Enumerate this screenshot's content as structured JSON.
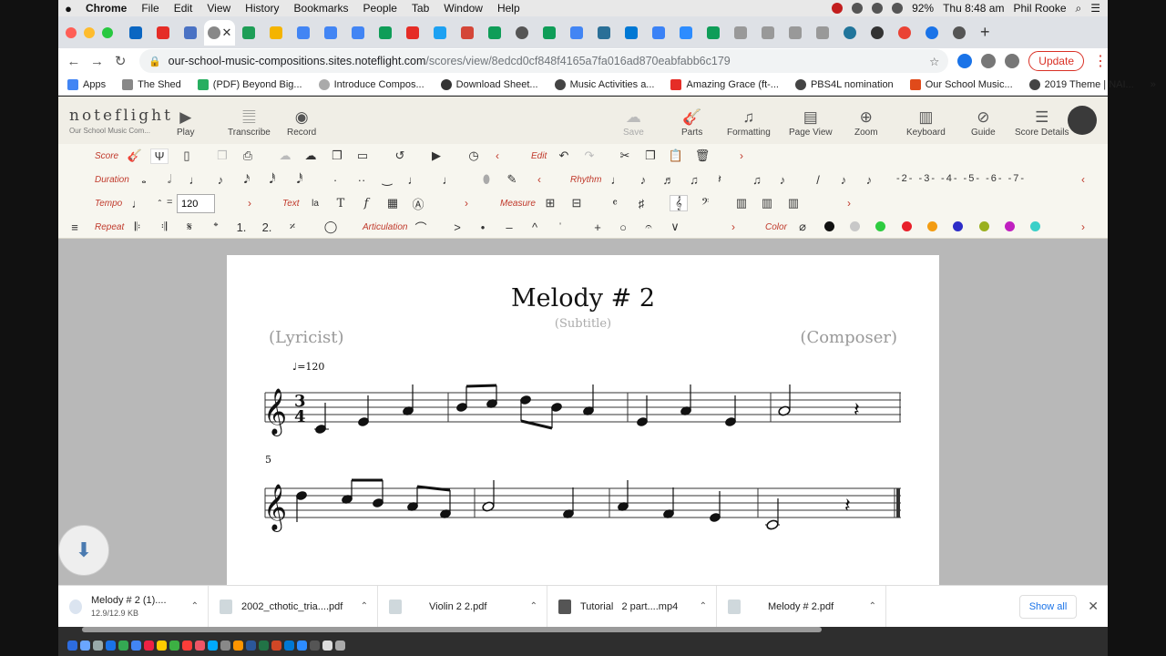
{
  "mac_menu": {
    "app": "Chrome",
    "items": [
      "File",
      "Edit",
      "View",
      "History",
      "Bookmarks",
      "People",
      "Tab",
      "Window",
      "Help"
    ],
    "battery": "92%",
    "clock": "Thu 8:48 am",
    "user": "Phil Rooke"
  },
  "browser": {
    "url_host": "our-school-music-compositions.sites.noteflight.com",
    "url_path": "/scores/view/8edcd0cf848f4165a7fa016ad870eabfabb6c179",
    "update_label": "Update",
    "bookmarks": [
      "Apps",
      "The Shed",
      "(PDF) Beyond Big...",
      "Introduce Compos...",
      "Download Sheet...",
      "Music Activities a...",
      "Amazing Grace (ft-...",
      "PBS4L nomination",
      "Our School Music...",
      "2019 Theme | NAI..."
    ],
    "bookmarks_more": "»"
  },
  "toolbar": {
    "brand": "noteflight",
    "brand_sub": "Our School Music Com...",
    "left_tools": [
      {
        "icon": "play-icon",
        "glyph": "▶",
        "label": "Play"
      },
      {
        "icon": "transcribe-icon",
        "glyph": "𝄚",
        "label": "Transcribe"
      },
      {
        "icon": "record-icon",
        "glyph": "◉",
        "label": "Record"
      }
    ],
    "right_tools": [
      {
        "icon": "cloud-save-icon",
        "glyph": "☁",
        "label": "Save",
        "disabled": true
      },
      {
        "icon": "guitar-icon",
        "glyph": "🎸",
        "label": "Parts",
        "disabled": false
      },
      {
        "icon": "formatting-icon",
        "glyph": "♫",
        "label": "Formatting",
        "disabled": false
      },
      {
        "icon": "page-view-icon",
        "glyph": "▤",
        "label": "Page View",
        "disabled": false
      },
      {
        "icon": "zoom-icon",
        "glyph": "⊕",
        "label": "Zoom",
        "disabled": false
      },
      {
        "icon": "keyboard-icon",
        "glyph": "▥",
        "label": "Keyboard",
        "disabled": false
      },
      {
        "icon": "guide-icon",
        "glyph": "⊘",
        "label": "Guide",
        "disabled": false
      },
      {
        "icon": "score-details-icon",
        "glyph": "☰",
        "label": "Score Details",
        "disabled": false
      }
    ]
  },
  "palette": {
    "score_label": "Score",
    "edit_label": "Edit",
    "duration_label": "Duration",
    "rhythm_label": "Rhythm",
    "tempo_label": "Tempo",
    "tempo_eq": "=",
    "tempo_value": "120",
    "text_label": "Text",
    "measure_label": "Measure",
    "repeat_label": "Repeat",
    "articulation_label": "Articulation",
    "color_label": "Color",
    "tuplets": [
      "2",
      "3",
      "4",
      "5",
      "6",
      "7"
    ],
    "colors": [
      "#111111",
      "#c8c8c8",
      "#2ecc40",
      "#e8202a",
      "#f39c12",
      "#2d2dc8",
      "#9ab020",
      "#c020c0",
      "#3ad0c8"
    ]
  },
  "score": {
    "title": "Melody # 2",
    "subtitle": "(Subtitle)",
    "lyricist": "(Lyricist)",
    "composer": "(Composer)",
    "tempo_marking": "=120",
    "measure_number": "5",
    "time_sig_top": "3",
    "time_sig_bottom": "4"
  },
  "downloads": [
    {
      "name": "Melody # 2 (1)....",
      "meta": "12.9/12.9 KB",
      "icon": "noteflight-file-icon"
    },
    {
      "name": "2002_cthotic_tria....pdf",
      "meta": "",
      "icon": "pdf-file-icon"
    },
    {
      "name": "Violin 2 2.pdf",
      "meta": "",
      "icon": "pdf-file-icon"
    },
    {
      "name": "Tutorial   2 part....mp4",
      "meta": "",
      "icon": "video-file-icon"
    },
    {
      "name": "Melody # 2.pdf",
      "meta": "",
      "icon": "pdf-file-icon"
    }
  ],
  "downloads_show_all": "Show all"
}
